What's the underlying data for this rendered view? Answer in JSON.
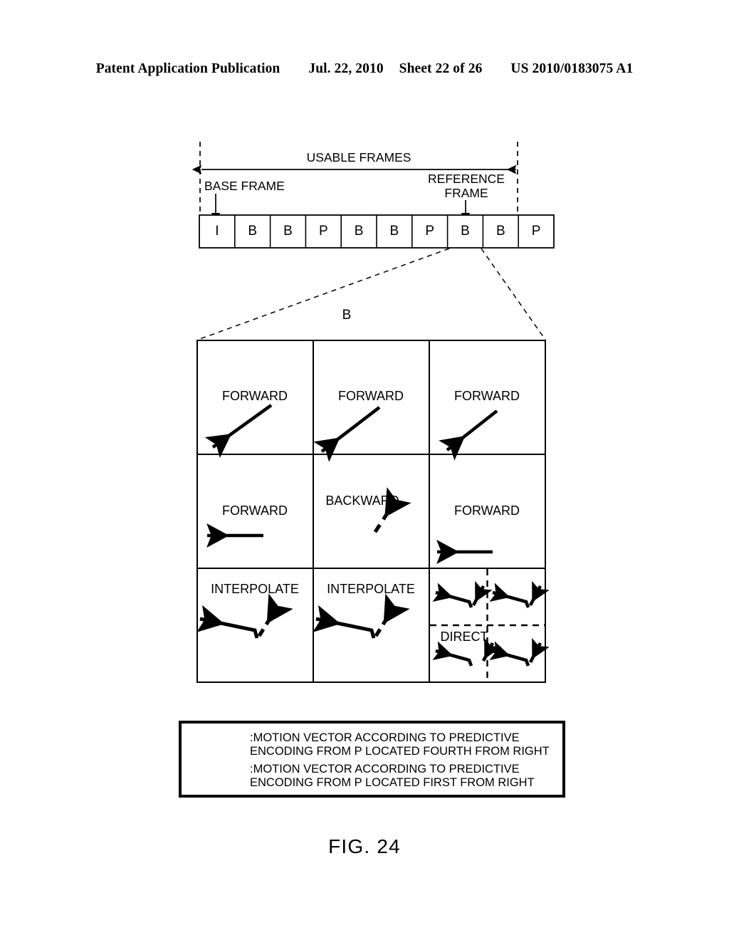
{
  "header": {
    "publication": "Patent Application Publication",
    "date": "Jul. 22, 2010",
    "sheet": "Sheet 22 of 26",
    "patent_number": "US 2010/0183075 A1"
  },
  "figure": {
    "caption": "FIG. 24",
    "usable_frames_label": "USABLE FRAMES",
    "base_frame_label": "BASE FRAME",
    "reference_frame_label_line1": "REFERENCE",
    "reference_frame_label_line2": "FRAME",
    "expanded_frame_label": "B",
    "frame_sequence": [
      {
        "type": "I"
      },
      {
        "type": "B"
      },
      {
        "type": "B"
      },
      {
        "type": "P"
      },
      {
        "type": "B"
      },
      {
        "type": "B"
      },
      {
        "type": "P"
      },
      {
        "type": "B"
      },
      {
        "type": "B"
      },
      {
        "type": "P"
      }
    ],
    "base_frame_index": 0,
    "reference_frame_index": 7,
    "macroblocks": [
      {
        "row": 0,
        "col": 0,
        "mode": "FORWARD"
      },
      {
        "row": 0,
        "col": 1,
        "mode": "FORWARD"
      },
      {
        "row": 0,
        "col": 2,
        "mode": "FORWARD"
      },
      {
        "row": 1,
        "col": 0,
        "mode": "FORWARD"
      },
      {
        "row": 1,
        "col": 1,
        "mode": "BACKWARD"
      },
      {
        "row": 1,
        "col": 2,
        "mode": "FORWARD"
      },
      {
        "row": 2,
        "col": 0,
        "mode": "INTERPOLATE"
      },
      {
        "row": 2,
        "col": 1,
        "mode": "INTERPOLATE"
      },
      {
        "row": 2,
        "col": 2,
        "mode": "DIRECT"
      }
    ],
    "legend": [
      {
        "style": "solid",
        "line1": ":MOTION VECTOR ACCORDING TO PREDICTIVE",
        "line2": "ENCODING FROM P LOCATED FOURTH FROM RIGHT"
      },
      {
        "style": "dashed",
        "line1": ":MOTION VECTOR ACCORDING TO PREDICTIVE",
        "line2": "ENCODING FROM P LOCATED FIRST FROM RIGHT"
      }
    ]
  },
  "colors": {
    "ink": "#000000",
    "paper": "#ffffff"
  }
}
